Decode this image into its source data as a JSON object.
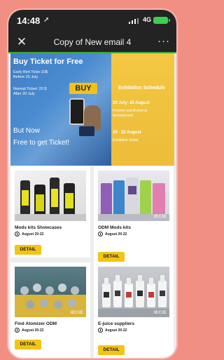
{
  "status_bar": {
    "time": "14:48",
    "network": "4G"
  },
  "nav": {
    "close_glyph": "✕",
    "title": "Copy of New email 4",
    "more_glyph": "···"
  },
  "colors": {
    "accent_yellow": "#f2c418",
    "progress_green": "#3ea83a",
    "banner_blue": "#4a8bd0",
    "banner_yellow": "#efc13d"
  },
  "banner": {
    "left": {
      "title": "Buy Ticket for Free",
      "early_line1": "Early Bird Ticke:10$",
      "early_line2": "Before 20 July",
      "normal_line1": "Normal Ticket: 20 $",
      "normal_line2": "After 20 July",
      "buy_label": "BUY",
      "cta_line1": "But Now",
      "cta_line2": "Free to get Ticket!"
    },
    "right": {
      "heading": "Exhibition Schedule",
      "date1": "20 July- 20 August",
      "note1_line1": "Preview and Business",
      "note1_line2": "Arrangement",
      "date2": "20 - 22 August",
      "note2": "Exhibition Visitor"
    }
  },
  "cards": [
    {
      "title": "Mods kits Showcases",
      "date": "August 20-22",
      "button": "DETAIL",
      "image_icon": "mods-kits-image",
      "logo": ""
    },
    {
      "title": "ODM Mods kits",
      "date": "August 20-22",
      "button": "DETAIL",
      "image_icon": "odm-mods-image",
      "logo": "IECIE"
    },
    {
      "title": "Find Atomizer ODM",
      "date": "August 20-22",
      "button": "DETAIL",
      "image_icon": "atomizer-image",
      "logo": "IECIE"
    },
    {
      "title": "E-juice suppliers",
      "date": "August 20-22",
      "button": "DETAIL",
      "image_icon": "ejuice-image",
      "logo": "IECIE"
    }
  ]
}
